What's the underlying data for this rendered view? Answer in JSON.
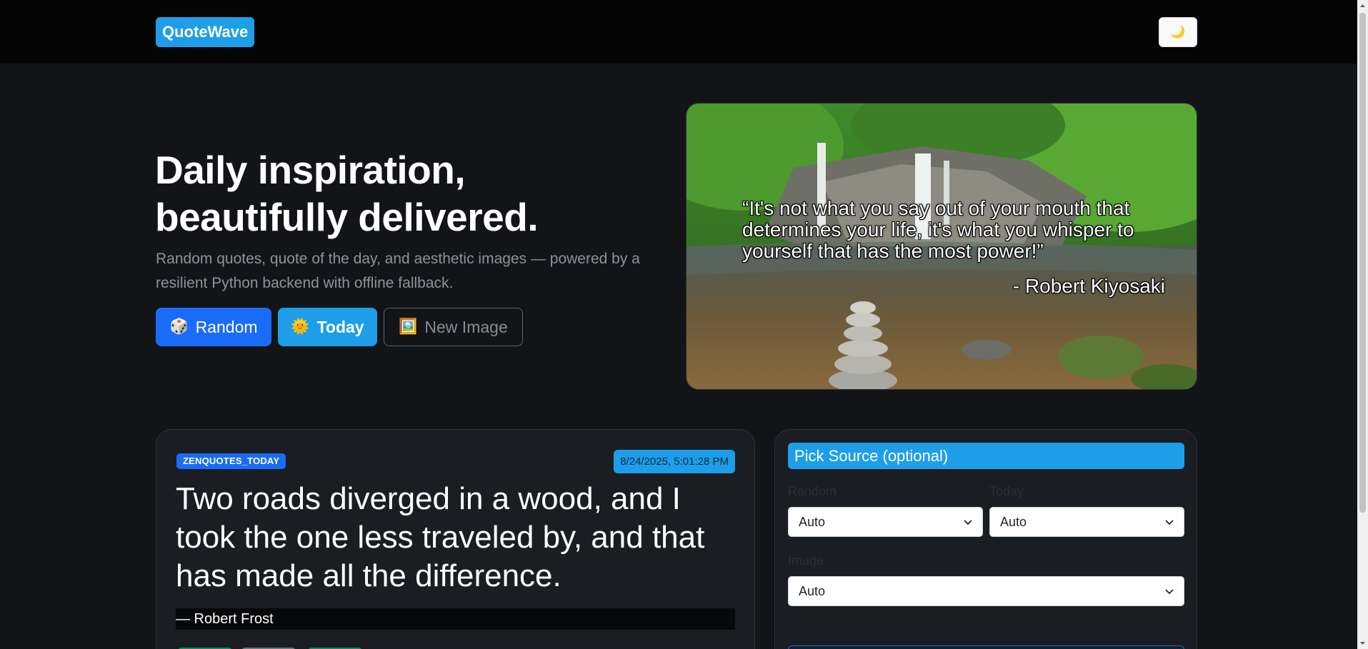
{
  "header": {
    "brand": "QuoteWave",
    "theme_toggle_icon": "🌙"
  },
  "hero": {
    "title_line1": "Daily inspiration,",
    "title_line2": "beautifully delivered.",
    "subtitle": "Random quotes, quote of the day, and aesthetic images — powered by a resilient Python backend with offline fallback.",
    "buttons": {
      "random": {
        "icon": "🎲",
        "label": "Random"
      },
      "today": {
        "icon": "🌞",
        "label": "Today"
      },
      "new_image": {
        "icon": "🖼️",
        "label": "New Image"
      }
    }
  },
  "image_quote": {
    "text": "“It's not what you say out of your mouth that determines your life, it's what you whisper to yourself that has the most power!”",
    "author": "- Robert Kiyosaki"
  },
  "quote_card": {
    "source": "ZENQUOTES_TODAY",
    "timestamp": "8/24/2025, 5:01:28 PM",
    "text": "Two roads diverged in a wood, and I took the one less traveled by, and that has made all the difference.",
    "author": "— Robert Frost"
  },
  "source_picker": {
    "title": "Pick Source (optional)",
    "random_label": "Random",
    "random_value": "Auto",
    "today_label": "Today",
    "today_value": "Auto",
    "image_label": "Image",
    "image_value": "Auto"
  },
  "colors": {
    "background": "#121418",
    "topbar": "#050506",
    "primary": "#1a6cf8",
    "accent": "#1e9ee9"
  }
}
